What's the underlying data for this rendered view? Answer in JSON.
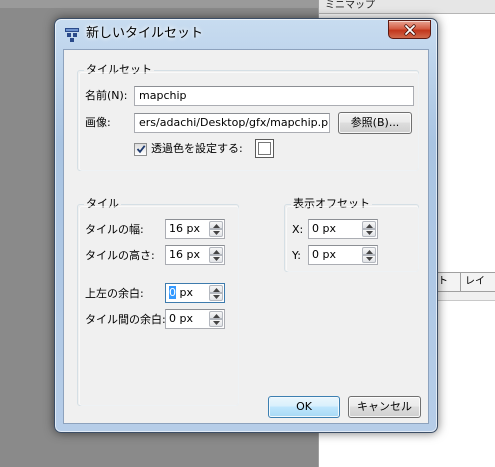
{
  "background": {
    "minimap_header": "ミニマップ",
    "tabs": [
      "ット",
      "レイ"
    ]
  },
  "dialog": {
    "title": "新しいタイルセット",
    "close_icon": "close-icon",
    "tileset_group": {
      "title": "タイルセット",
      "name_label": "名前(N):",
      "name_value": "mapchip",
      "image_label": "画像:",
      "image_value": "ers/adachi/Desktop/gfx/mapchip.png",
      "browse_label": "参照(B)...",
      "transparent_label": "透過色を設定する:",
      "transparent_checked": true,
      "transparent_color": "#ffffff"
    },
    "tile_group": {
      "title": "タイル",
      "width_label": "タイルの幅:",
      "width_value": "16 px",
      "height_label": "タイルの高さ:",
      "height_value": "16 px",
      "margin_label": "上左の余白:",
      "margin_value_selected": "0",
      "margin_value_rest": " px",
      "spacing_label": "タイル間の余白:",
      "spacing_value": "0 px"
    },
    "offset_group": {
      "title": "表示オフセット",
      "x_label": "X:",
      "x_value": "0 px",
      "y_label": "Y:",
      "y_value": "0 px"
    },
    "ok_label": "OK",
    "cancel_label": "キャンセル"
  },
  "colors": {
    "titlebar": "#b9d1ea",
    "close_button": "#c2361c",
    "client_bg": "#f0f0f0",
    "default_button_border": "#3c7fb1"
  }
}
